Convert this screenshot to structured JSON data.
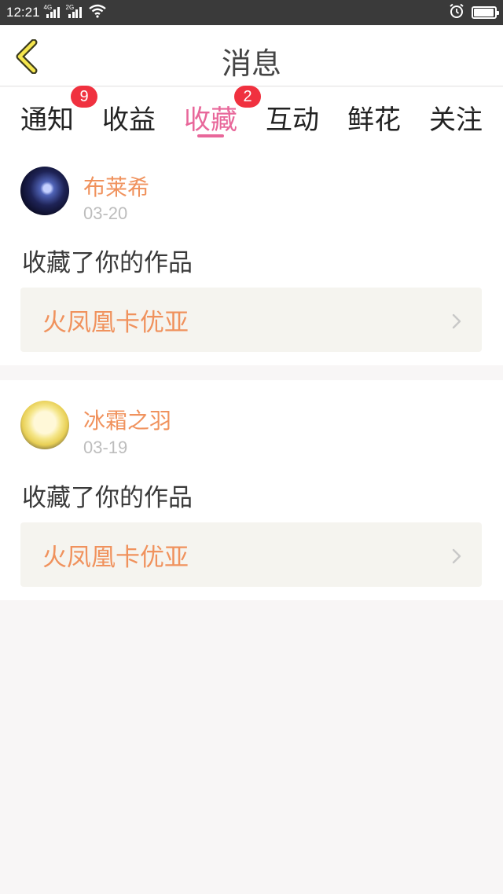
{
  "status_bar": {
    "time": "12:21",
    "network_1": "4G",
    "network_2": "2G",
    "battery_level": 0.95
  },
  "header": {
    "title": "消息"
  },
  "tabs": [
    {
      "label": "通知",
      "badge": "9"
    },
    {
      "label": "收益"
    },
    {
      "label": "收藏",
      "badge": "2",
      "active": true
    },
    {
      "label": "互动"
    },
    {
      "label": "鲜花"
    },
    {
      "label": "关注"
    }
  ],
  "messages": [
    {
      "user": "布莱希",
      "date": "03-20",
      "action": "收藏了你的作品",
      "work_title": "火凤凰卡优亚"
    },
    {
      "user": "冰霜之羽",
      "date": "03-19",
      "action": "收藏了你的作品",
      "work_title": "火凤凰卡优亚"
    }
  ],
  "colors": {
    "accent_pink": "#e8679a",
    "username_orange": "#f0925d",
    "badge_red": "#f0313f",
    "page_bg": "#f8f6f6"
  },
  "icons": {
    "back": "chevron-left-icon",
    "row_arrow": "chevron-right-icon",
    "wifi": "wifi-icon",
    "alarm": "alarm-icon",
    "battery": "battery-icon"
  }
}
